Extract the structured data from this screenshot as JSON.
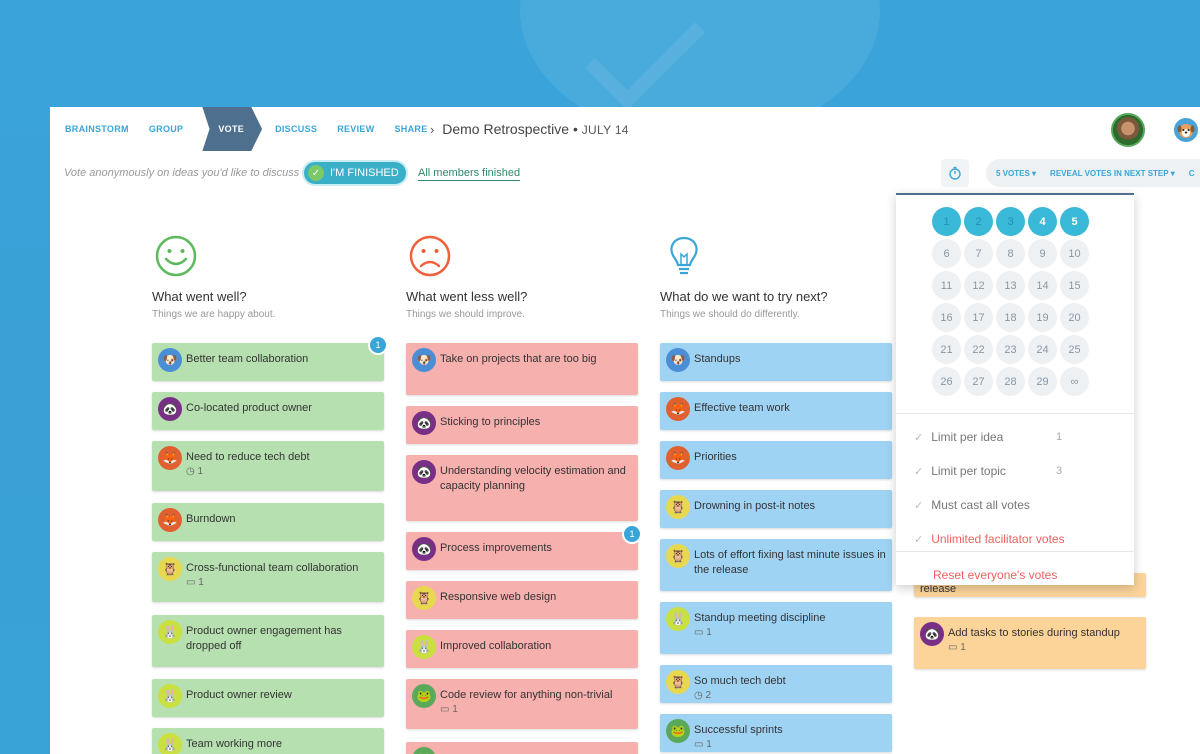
{
  "nav": {
    "steps": [
      "BRAINSTORM",
      "GROUP",
      "VOTE",
      "DISCUSS",
      "REVIEW",
      "SHARE"
    ],
    "title": "Demo Retrospective",
    "date": "JULY 14"
  },
  "subbar": {
    "hint": "Vote anonymously on ideas you'd like to discuss",
    "finished": "I'M FINISHED",
    "all_members": "All members finished",
    "votes": "5 VOTES",
    "reveal": "REVEAL VOTES IN NEXT STEP",
    "extra": "C"
  },
  "columns": [
    {
      "title": "What went well?",
      "subtitle": "Things we are happy about.",
      "color": "#b7e0b0",
      "cards": [
        {
          "text": "Better team collaboration",
          "ava": "dog",
          "badge": "1"
        },
        {
          "text": "Co-located product owner",
          "ava": "panda"
        },
        {
          "text": "Need to reduce tech debt",
          "ava": "fox",
          "meta": "◷ 1"
        },
        {
          "text": "Burndown",
          "ava": "fox"
        },
        {
          "text": "Cross-functional team collaboration",
          "ava": "owl",
          "meta": "▭ 1"
        },
        {
          "text": "Product owner engagement has dropped off",
          "ava": "rabbit"
        },
        {
          "text": "Product owner review",
          "ava": "rabbit"
        },
        {
          "text": "Team working more",
          "ava": "rabbit"
        }
      ]
    },
    {
      "title": "What went less well?",
      "subtitle": "Things we should improve.",
      "color": "#f6b0ae",
      "cards": [
        {
          "text": "Take on projects that are too big",
          "ava": "dog"
        },
        {
          "text": "Sticking to principles",
          "ava": "panda"
        },
        {
          "text": "Understanding velocity estimation and capacity planning",
          "ava": "panda"
        },
        {
          "text": "Process improvements",
          "ava": "panda",
          "badge": "1"
        },
        {
          "text": "Responsive web design",
          "ava": "owl"
        },
        {
          "text": "Improved collaboration",
          "ava": "rabbit"
        },
        {
          "text": "Code review for anything non-trivial",
          "ava": "frog",
          "meta": "▭ 1"
        },
        {
          "text": "",
          "ava": "frog"
        }
      ]
    },
    {
      "title": "What do we want to try next?",
      "subtitle": "Things we should do differently.",
      "color": "#9fd3f4",
      "cards": [
        {
          "text": "Standups",
          "ava": "dog"
        },
        {
          "text": "Effective team work",
          "ava": "fox"
        },
        {
          "text": "Priorities",
          "ava": "fox"
        },
        {
          "text": "Drowning in post-it notes",
          "ava": "owl"
        },
        {
          "text": "Lots of effort fixing last minute issues in the release",
          "ava": "owl"
        },
        {
          "text": "Standup meeting discipline",
          "ava": "rabbit",
          "meta": "▭ 1"
        },
        {
          "text": "So much tech debt",
          "ava": "owl",
          "meta": "◷ 2"
        },
        {
          "text": "Successful sprints",
          "ava": "frog",
          "meta": "▭ 1"
        }
      ]
    },
    {
      "cards": [
        {
          "text": "release",
          "ava": ""
        },
        {
          "text": "Add tasks to stories during standup",
          "ava": "panda",
          "meta": "▭ 1"
        }
      ]
    }
  ],
  "votes_dropdown": {
    "numbers": [
      "1",
      "2",
      "3",
      "4",
      "5",
      "6",
      "7",
      "8",
      "9",
      "10",
      "11",
      "12",
      "13",
      "14",
      "15",
      "16",
      "17",
      "18",
      "19",
      "20",
      "21",
      "22",
      "23",
      "24",
      "25",
      "26",
      "27",
      "28",
      "29",
      "∞"
    ],
    "selected": 5,
    "options": [
      {
        "label": "Limit per idea",
        "value": "1"
      },
      {
        "label": "Limit per topic",
        "value": "3"
      },
      {
        "label": "Must cast all votes",
        "value": ""
      },
      {
        "label": "Unlimited facilitator votes",
        "value": "",
        "red": true
      }
    ],
    "reset": "Reset everyone's votes"
  }
}
